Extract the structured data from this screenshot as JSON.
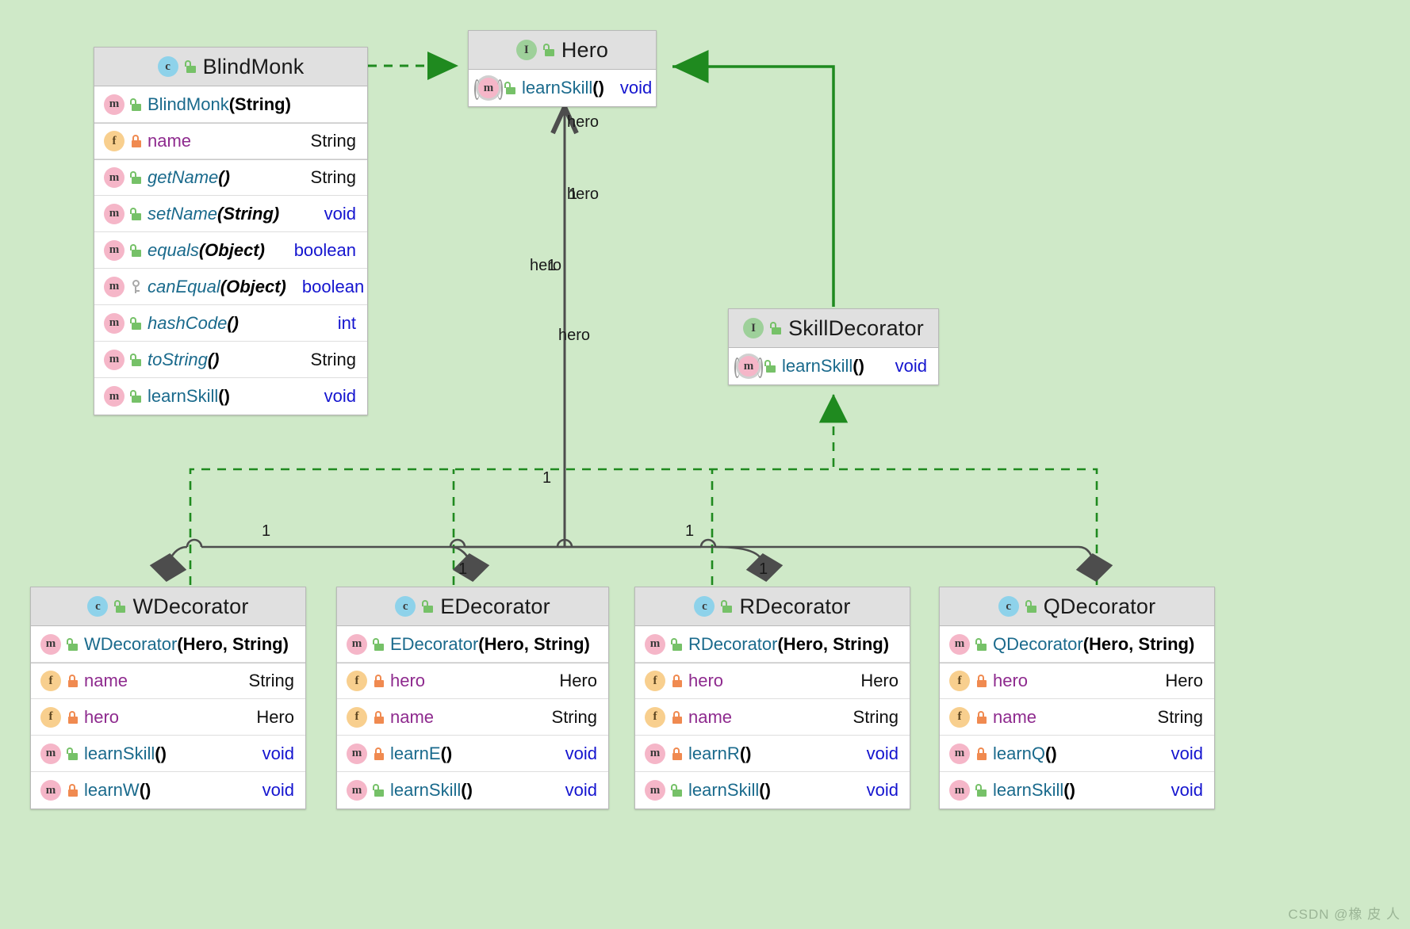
{
  "diagram": {
    "type": "uml-class-diagram",
    "background_color": "#cfe9c8",
    "watermark": "CSDN @橡 皮 人"
  },
  "classes": {
    "blindmonk": {
      "name": "BlindMonk",
      "stereotype": "c",
      "visibility_icon": "unlock-icon",
      "members": [
        {
          "icon": "m",
          "vis": "public",
          "name": "BlindMonk",
          "sig": "(String)",
          "type": "",
          "kind": "ctor",
          "italic": false
        },
        {
          "icon": "f",
          "vis": "private",
          "name": "name",
          "sig": "",
          "type": "String",
          "kind": "field",
          "italic": false
        },
        {
          "icon": "m",
          "vis": "public",
          "name": "getName",
          "sig": "()",
          "type": "String",
          "kind": "method",
          "italic": true
        },
        {
          "icon": "m",
          "vis": "public",
          "name": "setName",
          "sig": "(String)",
          "type": "void",
          "kind": "method",
          "italic": true
        },
        {
          "icon": "m",
          "vis": "public",
          "name": "equals",
          "sig": "(Object)",
          "type": "boolean",
          "kind": "method",
          "italic": true
        },
        {
          "icon": "m",
          "vis": "protected",
          "name": "canEqual",
          "sig": "(Object)",
          "type": "boolean",
          "kind": "method",
          "italic": true
        },
        {
          "icon": "m",
          "vis": "public",
          "name": "hashCode",
          "sig": "()",
          "type": "int",
          "kind": "method",
          "italic": true
        },
        {
          "icon": "m",
          "vis": "public",
          "name": "toString",
          "sig": "()",
          "type": "String",
          "kind": "method",
          "italic": true
        },
        {
          "icon": "m",
          "vis": "public",
          "name": "learnSkill",
          "sig": "()",
          "type": "void",
          "kind": "method",
          "italic": false
        }
      ]
    },
    "hero": {
      "name": "Hero",
      "stereotype": "I",
      "visibility_icon": "unlock-icon",
      "members": [
        {
          "icon": "m-abstract",
          "vis": "public",
          "name": "learnSkill",
          "sig": "()",
          "type": "void",
          "kind": "method",
          "italic": false
        }
      ]
    },
    "skilldecorator": {
      "name": "SkillDecorator",
      "stereotype": "I",
      "visibility_icon": "unlock-icon",
      "members": [
        {
          "icon": "m-abstract",
          "vis": "public",
          "name": "learnSkill",
          "sig": "()",
          "type": "void",
          "kind": "method",
          "italic": false
        }
      ]
    },
    "wdecorator": {
      "name": "WDecorator",
      "stereotype": "c",
      "visibility_icon": "unlock-icon",
      "members": [
        {
          "icon": "m",
          "vis": "public",
          "name": "WDecorator",
          "sig": "(Hero, String)",
          "type": "",
          "kind": "ctor",
          "italic": false
        },
        {
          "icon": "f",
          "vis": "private",
          "name": "name",
          "sig": "",
          "type": "String",
          "kind": "field",
          "italic": false
        },
        {
          "icon": "f",
          "vis": "private",
          "name": "hero",
          "sig": "",
          "type": "Hero",
          "kind": "field",
          "italic": false
        },
        {
          "icon": "m",
          "vis": "public",
          "name": "learnSkill",
          "sig": "()",
          "type": "void",
          "kind": "method",
          "italic": false
        },
        {
          "icon": "m",
          "vis": "private",
          "name": "learnW",
          "sig": "()",
          "type": "void",
          "kind": "method",
          "italic": false
        }
      ]
    },
    "edecorator": {
      "name": "EDecorator",
      "stereotype": "c",
      "visibility_icon": "unlock-icon",
      "members": [
        {
          "icon": "m",
          "vis": "public",
          "name": "EDecorator",
          "sig": "(Hero, String)",
          "type": "",
          "kind": "ctor",
          "italic": false
        },
        {
          "icon": "f",
          "vis": "private",
          "name": "hero",
          "sig": "",
          "type": "Hero",
          "kind": "field",
          "italic": false
        },
        {
          "icon": "f",
          "vis": "private",
          "name": "name",
          "sig": "",
          "type": "String",
          "kind": "field",
          "italic": false
        },
        {
          "icon": "m",
          "vis": "private",
          "name": "learnE",
          "sig": "()",
          "type": "void",
          "kind": "method",
          "italic": false
        },
        {
          "icon": "m",
          "vis": "public",
          "name": "learnSkill",
          "sig": "()",
          "type": "void",
          "kind": "method",
          "italic": false
        }
      ]
    },
    "rdecorator": {
      "name": "RDecorator",
      "stereotype": "c",
      "visibility_icon": "unlock-icon",
      "members": [
        {
          "icon": "m",
          "vis": "public",
          "name": "RDecorator",
          "sig": "(Hero, String)",
          "type": "",
          "kind": "ctor",
          "italic": false
        },
        {
          "icon": "f",
          "vis": "private",
          "name": "hero",
          "sig": "",
          "type": "Hero",
          "kind": "field",
          "italic": false
        },
        {
          "icon": "f",
          "vis": "private",
          "name": "name",
          "sig": "",
          "type": "String",
          "kind": "field",
          "italic": false
        },
        {
          "icon": "m",
          "vis": "private",
          "name": "learnR",
          "sig": "()",
          "type": "void",
          "kind": "method",
          "italic": false
        },
        {
          "icon": "m",
          "vis": "public",
          "name": "learnSkill",
          "sig": "()",
          "type": "void",
          "kind": "method",
          "italic": false
        }
      ]
    },
    "qdecorator": {
      "name": "QDecorator",
      "stereotype": "c",
      "visibility_icon": "unlock-icon",
      "members": [
        {
          "icon": "m",
          "vis": "public",
          "name": "QDecorator",
          "sig": "(Hero, String)",
          "type": "",
          "kind": "ctor",
          "italic": false
        },
        {
          "icon": "f",
          "vis": "private",
          "name": "hero",
          "sig": "",
          "type": "Hero",
          "kind": "field",
          "italic": false
        },
        {
          "icon": "f",
          "vis": "private",
          "name": "name",
          "sig": "",
          "type": "String",
          "kind": "field",
          "italic": false
        },
        {
          "icon": "m",
          "vis": "private",
          "name": "learnQ",
          "sig": "()",
          "type": "void",
          "kind": "method",
          "italic": false
        },
        {
          "icon": "m",
          "vis": "public",
          "name": "learnSkill",
          "sig": "()",
          "type": "void",
          "kind": "method",
          "italic": false
        }
      ]
    }
  },
  "edge_labels": {
    "hero_1": "hero",
    "hero_2": "hero",
    "hero_3": "hero",
    "hero_4": "hero",
    "mult_center": "1",
    "mult_w": "1",
    "mult_e": "1",
    "mult_r": "1",
    "mult_r2": "1",
    "mult_mid": "1"
  },
  "colors": {
    "background": "#cfe9c8",
    "header_fill": "#e0e0e0",
    "class_badge": "#8ed2ea",
    "interface_badge": "#9ed09a",
    "method_badge": "#f5b6c8",
    "field_badge": "#f8cf8e",
    "public_lock": "#76c168",
    "private_lock": "#f08a50",
    "inherit_edge": "#1f8a1f",
    "compose_edge": "#4d4d4d",
    "method_text": "#1a6a8c",
    "field_text": "#8e2a8e",
    "primitive_text": "#1414cf"
  }
}
